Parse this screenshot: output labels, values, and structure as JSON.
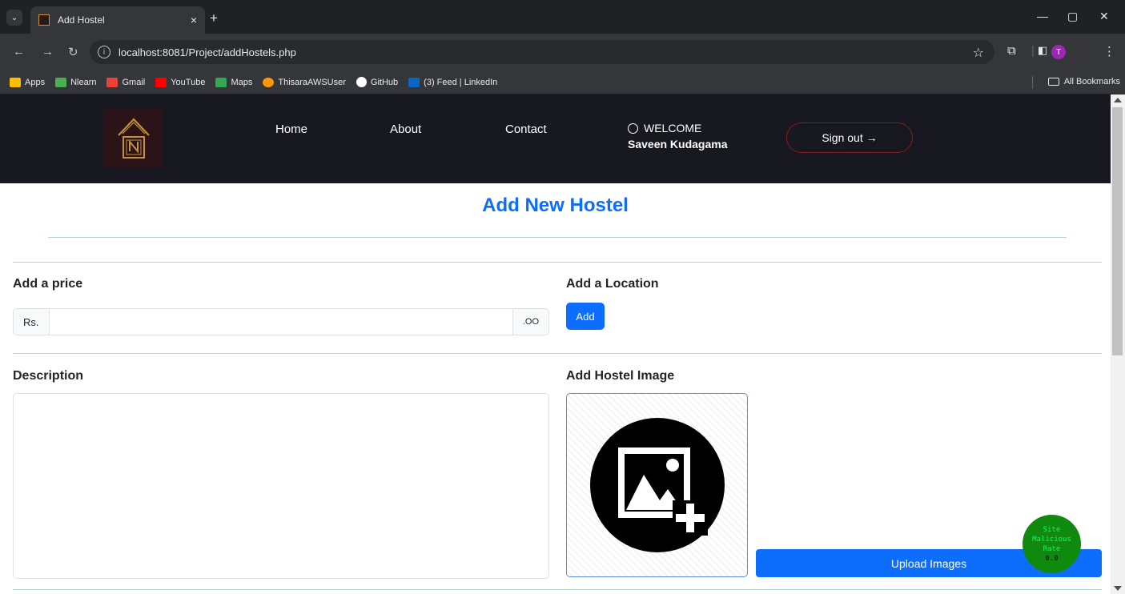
{
  "browser": {
    "tab_title": "Add Hostel",
    "tab_close": "×",
    "new_tab": "+",
    "url": "localhost:8081/Project/addHostels.php",
    "profile_initial": "T",
    "bookmarks": [
      {
        "label": "Apps",
        "color": "#fbbc04"
      },
      {
        "label": "Nlearn",
        "color": "#4caf50"
      },
      {
        "label": "Gmail",
        "color": "#ea4335"
      },
      {
        "label": "YouTube",
        "color": "#ff0000"
      },
      {
        "label": "Maps",
        "color": "#34a853"
      },
      {
        "label": "ThisaraAWSUser",
        "color": "#ff9800"
      },
      {
        "label": "GitHub",
        "color": "#ffffff"
      },
      {
        "label": "(3) Feed | LinkedIn",
        "color": "#0a66c2"
      }
    ],
    "all_bookmarks": "All Bookmarks"
  },
  "header": {
    "nav": [
      "Home",
      "About",
      "Contact"
    ],
    "welcome_label": "WELCOME",
    "user_name": "Saveen Kudagama",
    "signout_label": "Sign out →"
  },
  "main": {
    "title": "Add New Hostel",
    "price": {
      "label": "Add a price",
      "prefix": "Rs.",
      "suffix": ".OO",
      "value": ""
    },
    "location": {
      "label": "Add a Location",
      "button": "Add"
    },
    "description": {
      "label": "Description",
      "value": ""
    },
    "image": {
      "label": "Add Hostel Image",
      "upload_button": "Upload Images"
    }
  },
  "widget": {
    "line1": "Site",
    "line2": "Malicious",
    "line3": "Rate",
    "value": "0.0"
  },
  "colors": {
    "primary": "#0d6efd",
    "header_bg": "#171820",
    "signout_border": "#8b1a1a",
    "widget_bg": "#0f8a0f"
  }
}
